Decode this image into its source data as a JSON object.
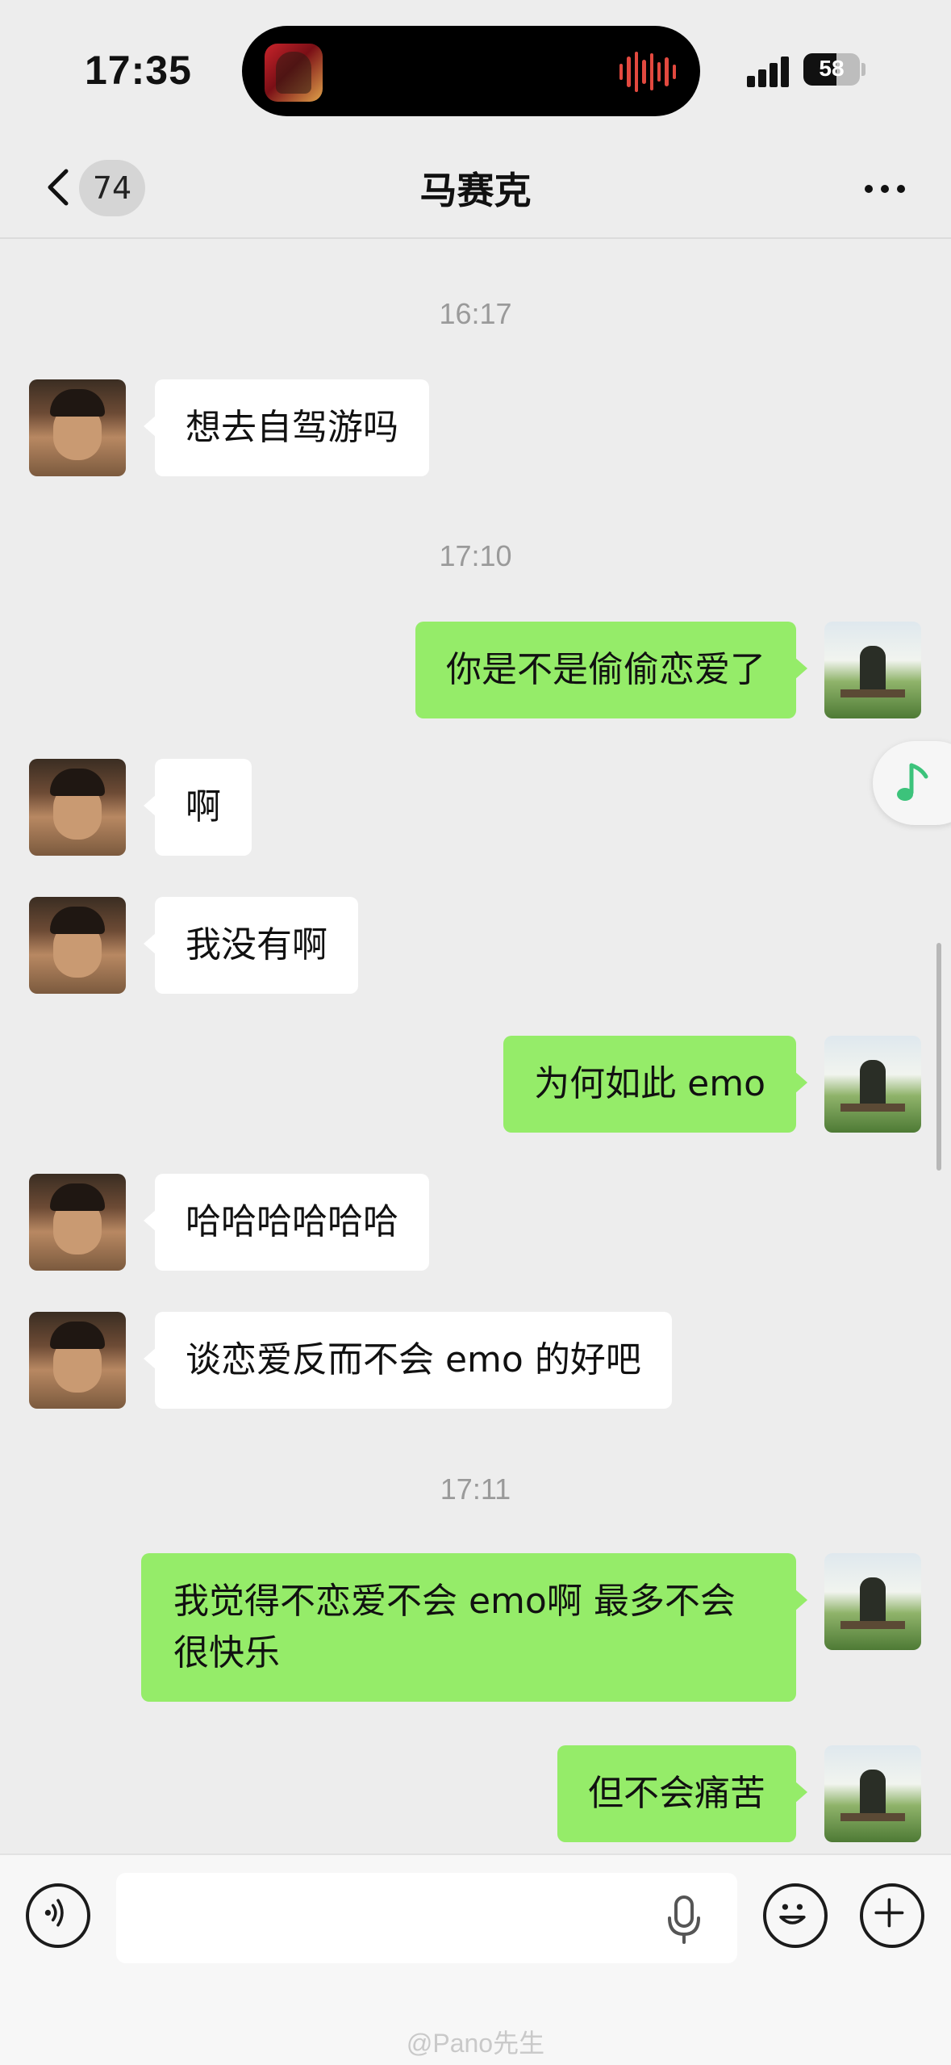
{
  "status_bar": {
    "time": "17:35",
    "battery": "58",
    "battery_level": 0.58
  },
  "header": {
    "unread_count": "74",
    "title": "马赛克"
  },
  "timestamps": [
    "16:17",
    "17:10",
    "17:11"
  ],
  "messages": [
    {
      "from": "friend",
      "text": "想去自驾游吗"
    },
    {
      "from": "me",
      "text": "你是不是偷偷恋爱了"
    },
    {
      "from": "friend",
      "text": "啊"
    },
    {
      "from": "friend",
      "text": "我没有啊"
    },
    {
      "from": "me",
      "text": "为何如此 emo"
    },
    {
      "from": "friend",
      "text": "哈哈哈哈哈哈"
    },
    {
      "from": "friend",
      "text": "谈恋爱反而不会 emo 的好吧"
    },
    {
      "from": "me",
      "text": "我觉得不恋爱不会 emo啊 最多不会很快乐"
    },
    {
      "from": "me",
      "text": "但不会痛苦"
    }
  ],
  "input": {
    "value": ""
  },
  "watermark": "@Pano先生",
  "colors": {
    "background": "#ededed",
    "bubble_in": "#ffffff",
    "bubble_out": "#95ec69",
    "music_accent": "#3cc37b"
  },
  "icons": {
    "back": "chevron-left-icon",
    "more": "more-dots-icon",
    "voice": "voice-icon",
    "mic": "microphone-icon",
    "emoji": "emoji-icon",
    "plus": "plus-icon",
    "music": "music-note-icon"
  }
}
